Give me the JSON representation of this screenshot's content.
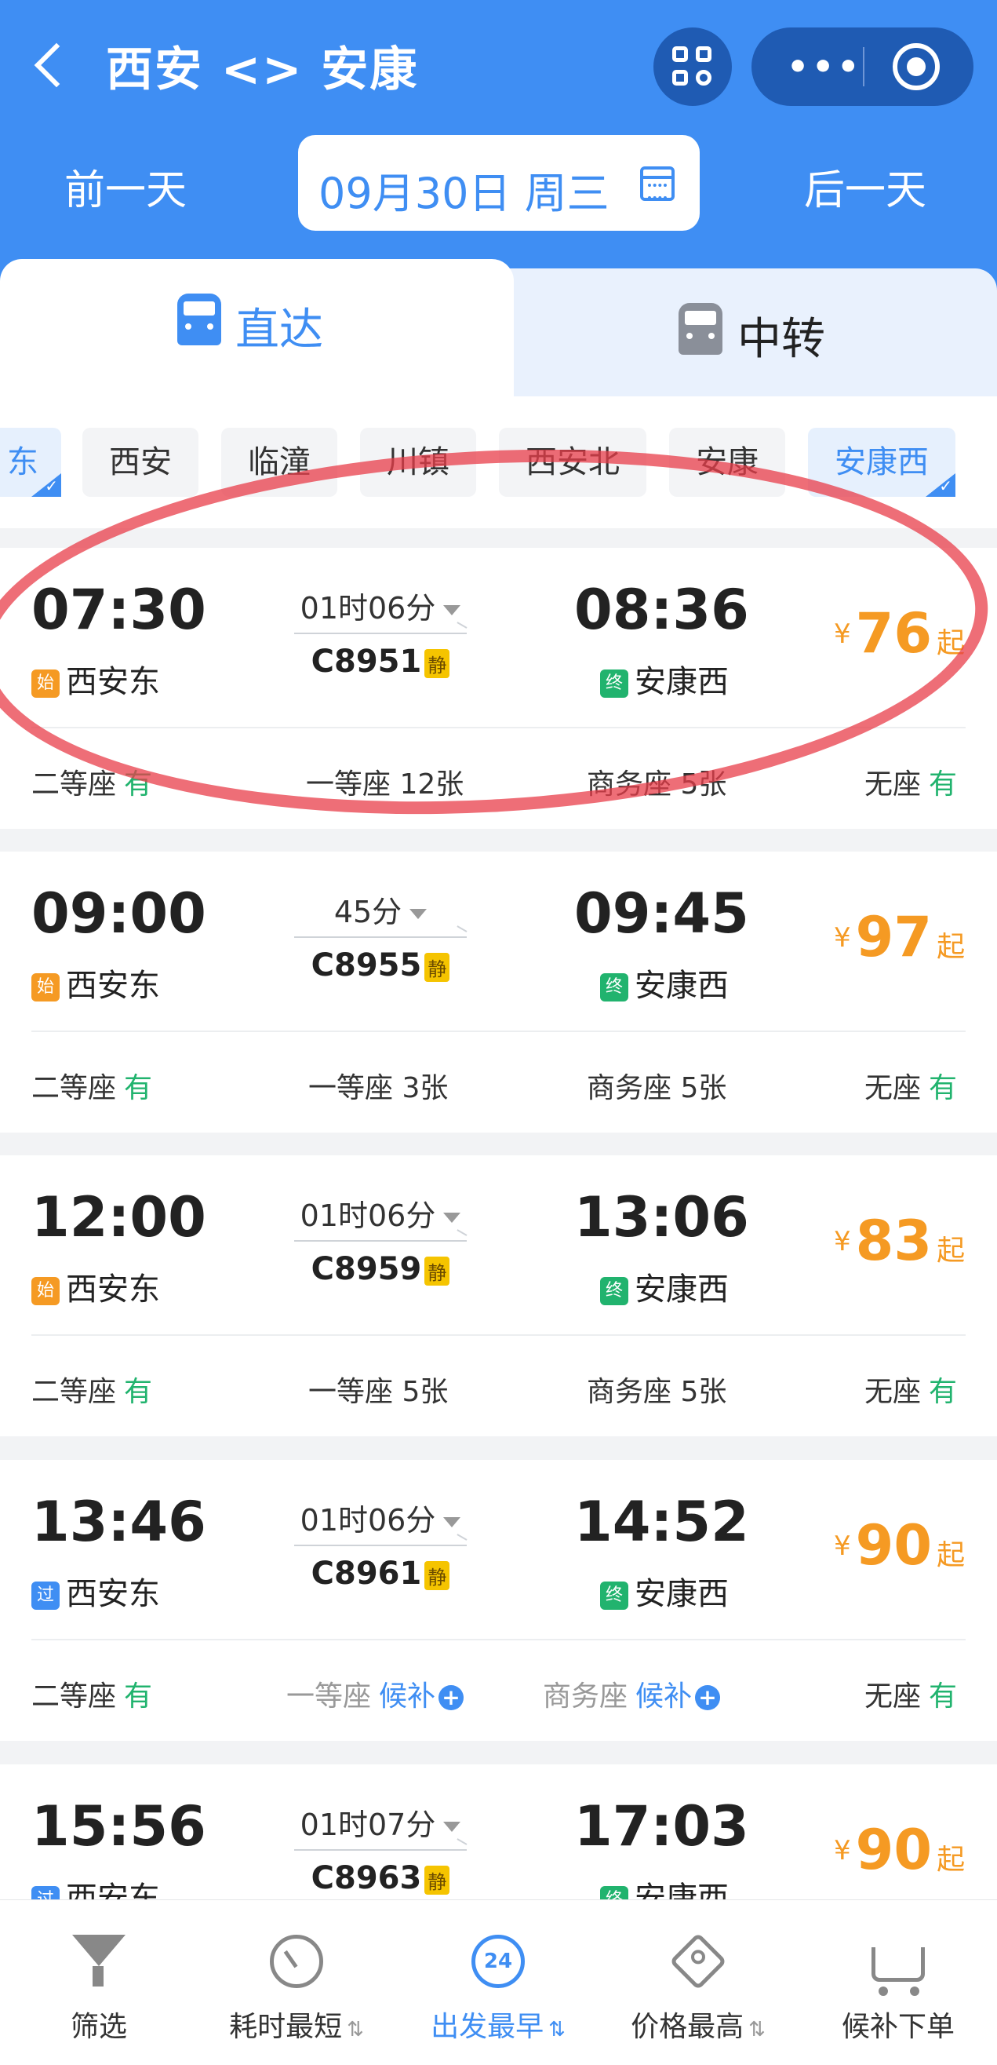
{
  "header": {
    "title": "西安 <> 安康",
    "prev_day": "前一天",
    "date": "09月30日 周三",
    "next_day": "后一天"
  },
  "tabs": [
    {
      "label": "直达",
      "active": true
    },
    {
      "label": "中转",
      "active": false
    }
  ],
  "stations": [
    {
      "label": "东",
      "selected": true
    },
    {
      "label": "西安",
      "selected": false
    },
    {
      "label": "临潼",
      "selected": false
    },
    {
      "label": "川镇",
      "selected": false
    },
    {
      "label": "西安北",
      "selected": false
    },
    {
      "label": "安康",
      "selected": false
    },
    {
      "label": "安康西",
      "selected": true
    }
  ],
  "trains": [
    {
      "dep_time": "07:30",
      "arr_time": "08:36",
      "duration": "01时06分",
      "train_no": "C8951",
      "quiet_tag": "静",
      "dep_badge": "始",
      "dep_station": "西安东",
      "arr_badge": "终",
      "arr_station": "安康西",
      "price_symbol": "¥",
      "price": "76",
      "price_suffix": "起",
      "seats": [
        {
          "label": "二等座",
          "status": "有"
        },
        {
          "label": "一等座",
          "status": "12张"
        },
        {
          "label": "商务座",
          "status": "5张"
        },
        {
          "label": "无座",
          "status": "有"
        }
      ]
    },
    {
      "dep_time": "09:00",
      "arr_time": "09:45",
      "duration": "45分",
      "train_no": "C8955",
      "quiet_tag": "静",
      "dep_badge": "始",
      "dep_station": "西安东",
      "arr_badge": "终",
      "arr_station": "安康西",
      "price_symbol": "¥",
      "price": "97",
      "price_suffix": "起",
      "seats": [
        {
          "label": "二等座",
          "status": "有"
        },
        {
          "label": "一等座",
          "status": "3张"
        },
        {
          "label": "商务座",
          "status": "5张"
        },
        {
          "label": "无座",
          "status": "有"
        }
      ]
    },
    {
      "dep_time": "12:00",
      "arr_time": "13:06",
      "duration": "01时06分",
      "train_no": "C8959",
      "quiet_tag": "静",
      "dep_badge": "始",
      "dep_station": "西安东",
      "arr_badge": "终",
      "arr_station": "安康西",
      "price_symbol": "¥",
      "price": "83",
      "price_suffix": "起",
      "seats": [
        {
          "label": "二等座",
          "status": "有"
        },
        {
          "label": "一等座",
          "status": "5张"
        },
        {
          "label": "商务座",
          "status": "5张"
        },
        {
          "label": "无座",
          "status": "有"
        }
      ]
    },
    {
      "dep_time": "13:46",
      "arr_time": "14:52",
      "duration": "01时06分",
      "train_no": "C8961",
      "quiet_tag": "静",
      "dep_badge": "过",
      "dep_station": "西安东",
      "arr_badge": "终",
      "arr_station": "安康西",
      "price_symbol": "¥",
      "price": "90",
      "price_suffix": "起",
      "seats": [
        {
          "label": "二等座",
          "status": "有"
        },
        {
          "label": "一等座",
          "status": "候补"
        },
        {
          "label": "商务座",
          "status": "候补"
        },
        {
          "label": "无座",
          "status": "有"
        }
      ]
    },
    {
      "dep_time": "15:56",
      "arr_time": "17:03",
      "duration": "01时07分",
      "train_no": "C8963",
      "quiet_tag": "静",
      "dep_badge": "过",
      "dep_station": "西安东",
      "arr_badge": "终",
      "arr_station": "安康西",
      "price_symbol": "¥",
      "price": "90",
      "price_suffix": "起",
      "seats": []
    }
  ],
  "bottom_nav": [
    {
      "label": "筛选",
      "icon": "filter-icon"
    },
    {
      "label": "耗时最短",
      "icon": "clock-icon"
    },
    {
      "label": "出发最早",
      "icon": "24h-icon",
      "icon_text": "24"
    },
    {
      "label": "价格最高",
      "icon": "price-tag-icon"
    },
    {
      "label": "候补下单",
      "icon": "cart-icon"
    }
  ],
  "colors": {
    "header_blue": "#3f8ef3",
    "price_orange": "#f59a23",
    "available_green": "#21b36e",
    "annotation_red": "#e83e4a"
  }
}
